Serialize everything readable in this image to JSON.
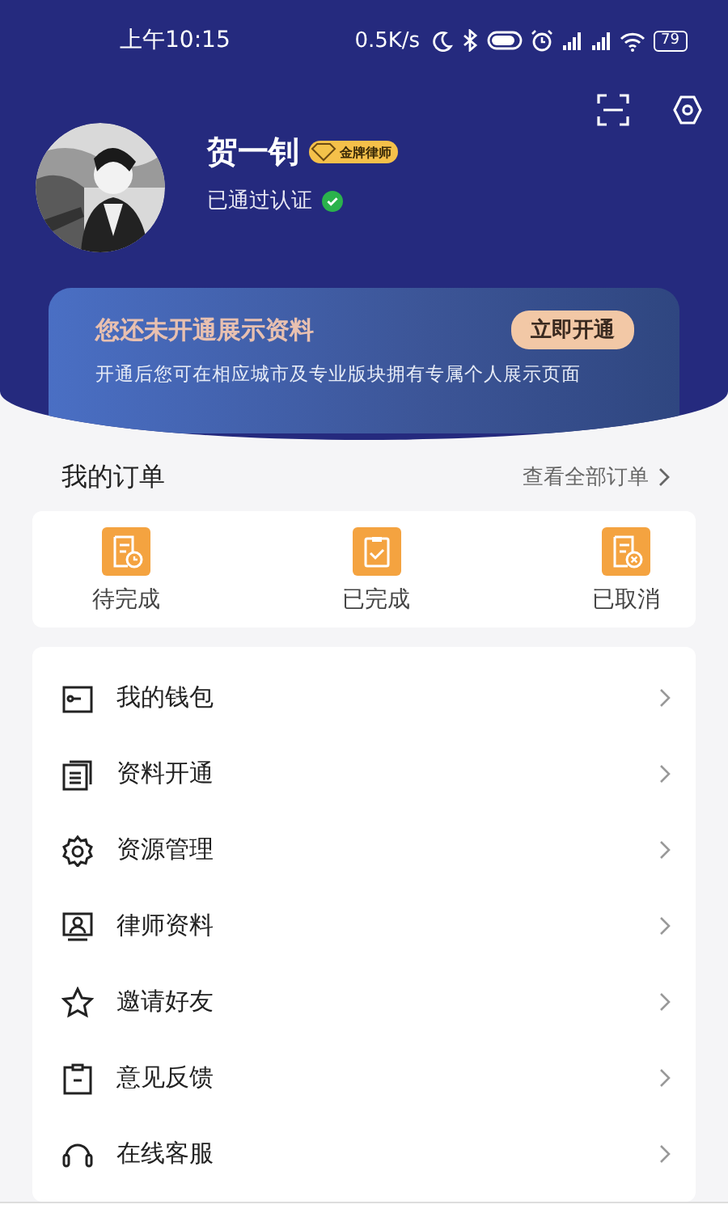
{
  "status_bar": {
    "time": "上午10:15",
    "speed": "0.5K/s",
    "battery": "79"
  },
  "profile": {
    "name": "贺一钊",
    "badge": "金牌律师",
    "verified_text": "已通过认证",
    "verified": true
  },
  "promo": {
    "title": "您还未开通展示资料",
    "subtitle": "开通后您可在相应城市及专业版块拥有专属个人展示页面",
    "button": "立即开通"
  },
  "orders": {
    "title": "我的订单",
    "link": "查看全部订单",
    "items": [
      {
        "kind": "pending",
        "label": "待完成"
      },
      {
        "kind": "done",
        "label": "已完成"
      },
      {
        "kind": "cancelled",
        "label": "已取消"
      }
    ]
  },
  "menu": [
    {
      "kind": "wallet",
      "label": "我的钱包"
    },
    {
      "kind": "document",
      "label": "资料开通"
    },
    {
      "kind": "gear",
      "label": "资源管理"
    },
    {
      "kind": "profile",
      "label": "律师资料"
    },
    {
      "kind": "star",
      "label": "邀请好友"
    },
    {
      "kind": "clipboard",
      "label": "意见反馈"
    },
    {
      "kind": "headset",
      "label": "在线客服"
    }
  ]
}
